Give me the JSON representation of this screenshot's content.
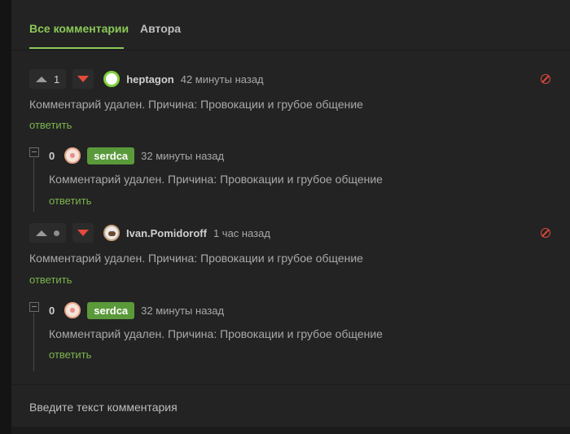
{
  "tabs": {
    "all_comments": "Все комментарии",
    "author": "Автора"
  },
  "comments": [
    {
      "score": "1",
      "author": "heptagon",
      "time": "42 минуты назад",
      "text": "Комментарий удален. Причина: Провокации и грубое общение",
      "reply": "ответить",
      "reply_item": {
        "score": "0",
        "author": "serdca",
        "time": "32 минуты назад",
        "text": "Комментарий удален. Причина: Провокации и грубое общение",
        "reply": "ответить"
      }
    },
    {
      "score": "",
      "author": "Ivan.Pomidoroff",
      "time": "1 час назад",
      "text": "Комментарий удален. Причина: Провокации и грубое общение",
      "reply": "ответить",
      "reply_item": {
        "score": "0",
        "author": "serdca",
        "time": "32 минуты назад",
        "text": "Комментарий удален. Причина: Провокации и грубое общение",
        "reply": "ответить"
      }
    }
  ],
  "input": {
    "placeholder": "Введите текст комментария"
  },
  "colors": {
    "accent": "#8ac858",
    "downvote": "#e44a3a",
    "author_badge": "#5a9a3a"
  }
}
